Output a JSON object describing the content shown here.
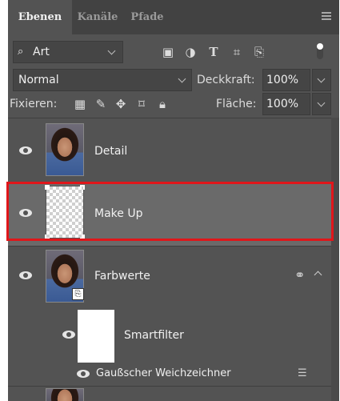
{
  "tabs": [
    {
      "label": "Ebenen",
      "active": true
    },
    {
      "label": "Kanäle",
      "active": false
    },
    {
      "label": "Pfade",
      "active": false
    }
  ],
  "filter": {
    "kind_label": "Art",
    "icons": [
      "image-filter-icon",
      "adjustment-filter-icon",
      "type-filter-icon",
      "shape-filter-icon",
      "smartobject-filter-icon"
    ]
  },
  "blend": {
    "mode": "Normal",
    "opacity_label": "Deckkraft:",
    "opacity_value": "100%"
  },
  "lock": {
    "label": "Fixieren:",
    "icons": [
      "lock-transparency-icon",
      "lock-pixels-icon",
      "lock-position-icon",
      "lock-artboard-icon",
      "lock-all-icon"
    ],
    "fill_label": "Fläche:",
    "fill_value": "100%"
  },
  "layers": [
    {
      "name": "Detail",
      "visible": true,
      "thumb": "portrait"
    },
    {
      "name": "Make Up",
      "visible": true,
      "thumb": "transparent",
      "selected": true,
      "highlight_color": "#e0161a"
    },
    {
      "name": "Farbwerte",
      "visible": true,
      "thumb": "portrait-smart"
    }
  ],
  "smartfilter": {
    "label": "Smartfilter",
    "filters": [
      {
        "name": "Gaußscher Weichzeichner"
      }
    ]
  }
}
